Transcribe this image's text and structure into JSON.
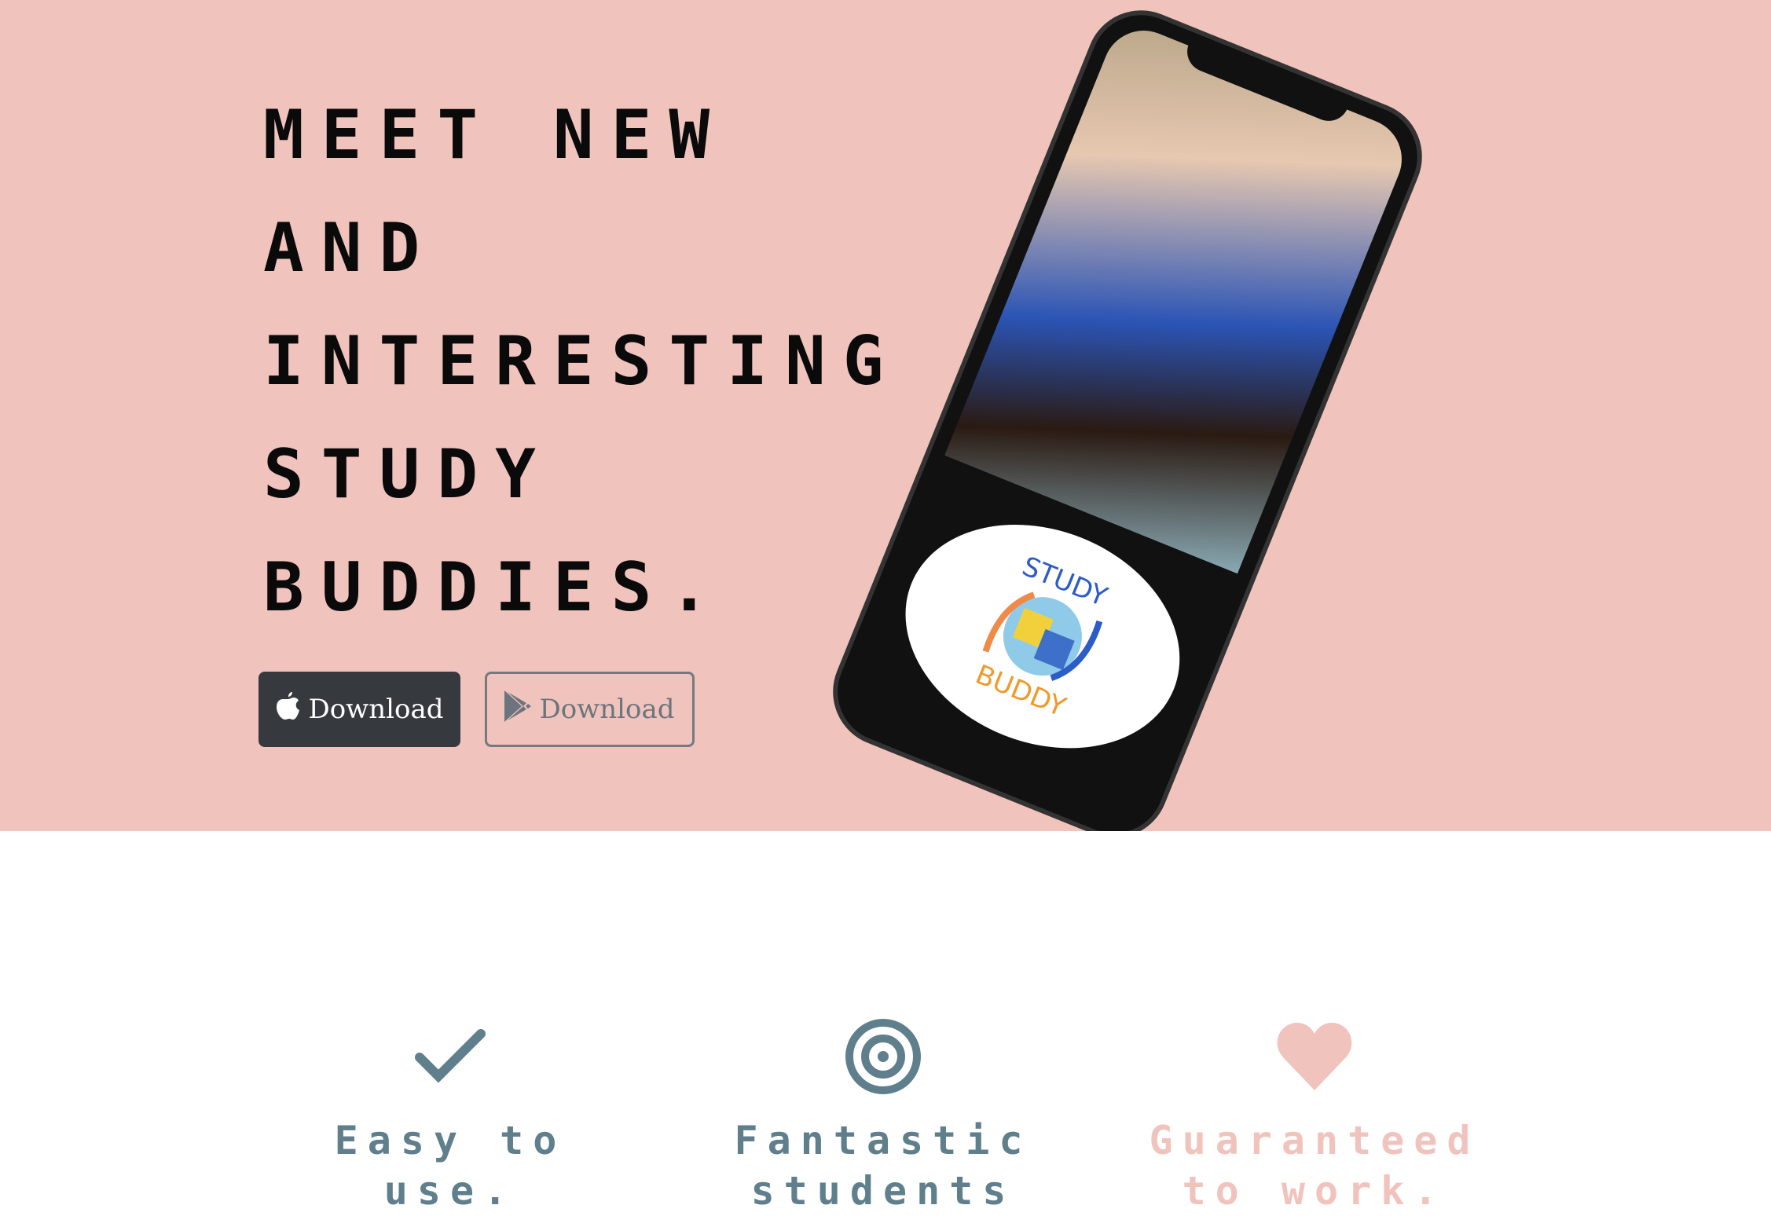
{
  "hero": {
    "headline_lines": [
      "Meet new",
      "and",
      "interesting",
      "study",
      "buddies."
    ],
    "apple_button": {
      "label": "Download",
      "icon": "apple-icon"
    },
    "play_button": {
      "label": "Download",
      "icon": "google-play-icon"
    },
    "phone_logo": {
      "top": "STUDY",
      "bottom": "BUDDY"
    },
    "colors": {
      "background": "#f1c3bd",
      "dark": "#363a3f"
    }
  },
  "features": [
    {
      "icon": "checkmark-icon",
      "title": "Easy to use.",
      "color": "#5f7f8c"
    },
    {
      "icon": "target-icon",
      "title": "Fantastic students",
      "color": "#5f7f8c"
    },
    {
      "icon": "heart-icon",
      "title": "Guaranteed to work.",
      "color": "#f1c3bd"
    }
  ]
}
